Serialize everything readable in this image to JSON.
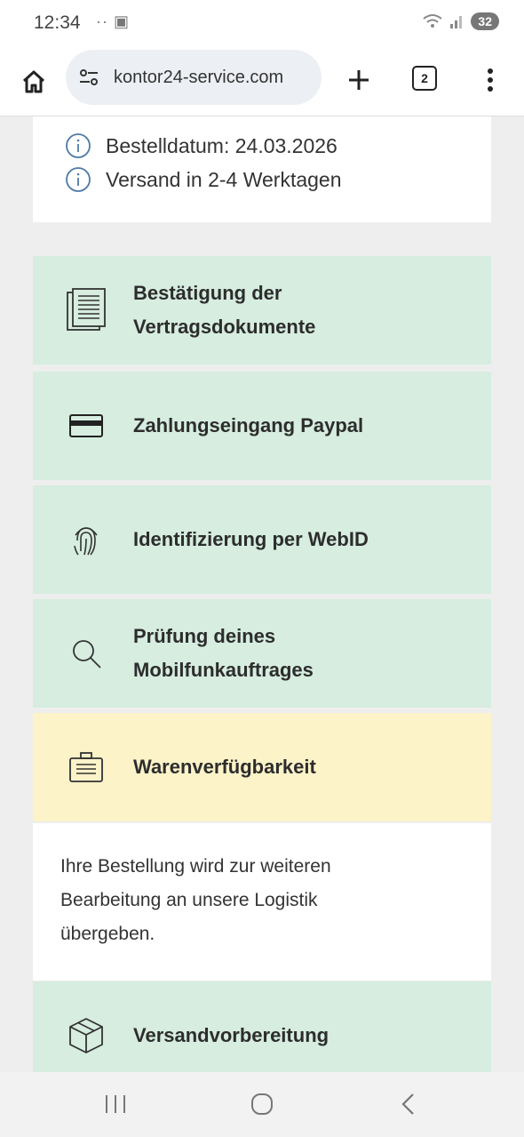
{
  "status_bar": {
    "time": "12:34",
    "extra": "·· ▣",
    "battery": "32"
  },
  "browser": {
    "url": "kontor24-service.com",
    "tab_count": "2"
  },
  "order_info": {
    "items": [
      {
        "icon": "info-icon",
        "text": "Bestelldatum: 24.03.2026"
      },
      {
        "icon": "info-icon",
        "text": "Versand in 2-4 Werktagen"
      }
    ]
  },
  "steps": [
    {
      "icon": "document-icon",
      "label_line1": "Bestätigung der",
      "label_line2": "Vertragsdokumente",
      "status": "done"
    },
    {
      "icon": "credit-card-icon",
      "label_line1": "Zahlungseingang Paypal",
      "label_line2": "",
      "status": "done"
    },
    {
      "icon": "fingerprint-icon",
      "label_line1": "Identifizierung per WebID",
      "label_line2": "",
      "status": "done"
    },
    {
      "icon": "search-icon",
      "label_line1": "Prüfung deines",
      "label_line2": "Mobilfunkauftrages",
      "status": "done"
    },
    {
      "icon": "briefcase-icon",
      "label_line1": "Warenverfügbarkeit",
      "label_line2": "",
      "status": "pending"
    },
    {
      "icon": "package-icon",
      "label_line1": "Versandvorbereitung",
      "label_line2": "",
      "status": "done"
    }
  ],
  "step_description": {
    "line1": "Ihre Bestellung wird zur weiteren",
    "line2": "Bearbeitung an unsere Logistik",
    "line3": "übergeben."
  },
  "colors": {
    "step_done": "#d6ede0",
    "step_pending": "#fdf3c9",
    "page_bg": "#eeeeee"
  }
}
